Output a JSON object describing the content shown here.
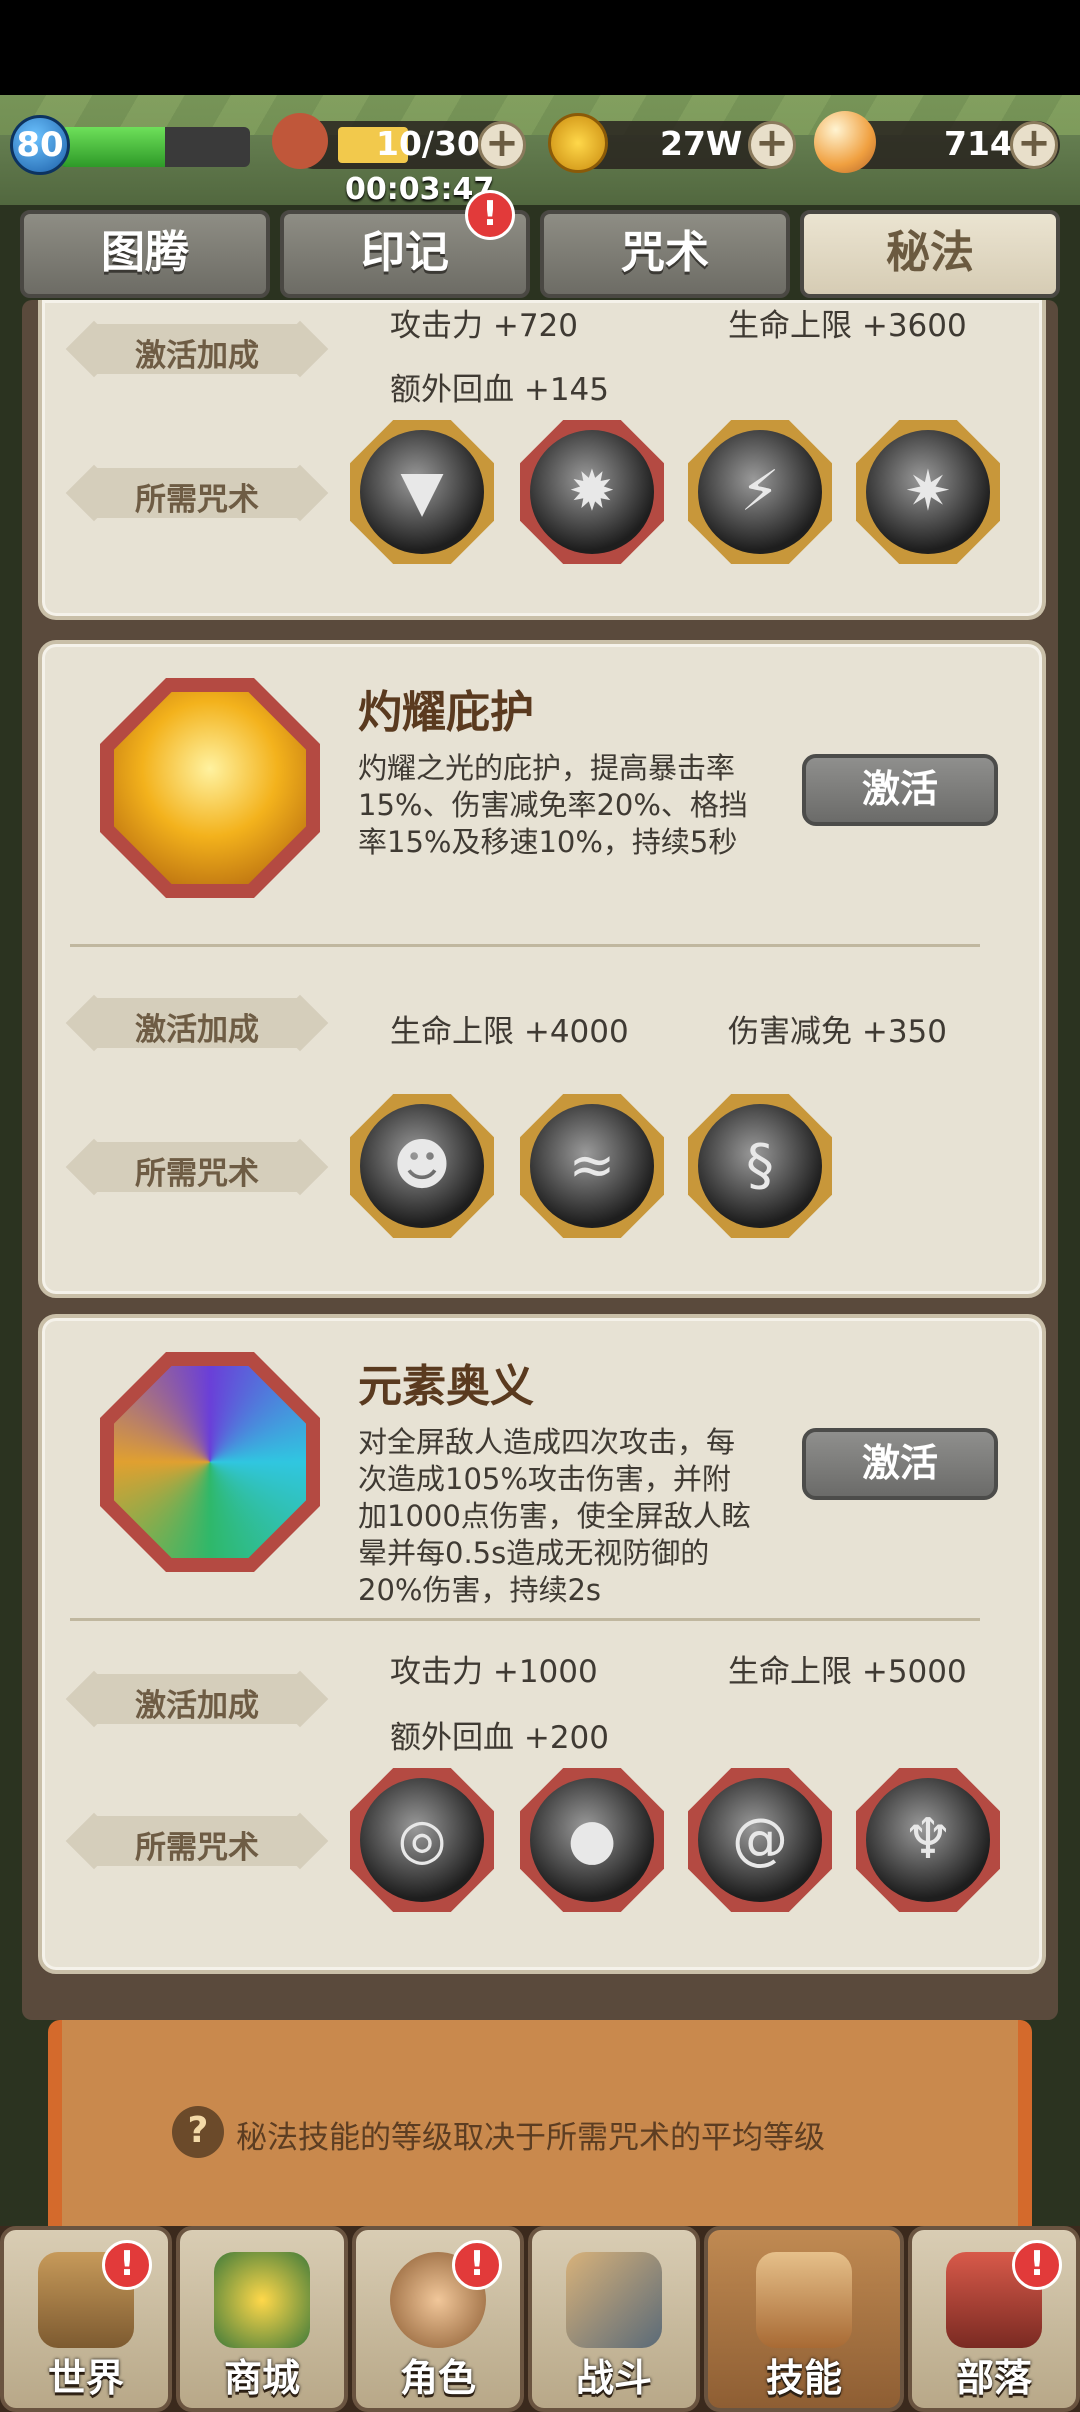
{
  "header": {
    "level": "80",
    "xp_fraction": 0.55,
    "stamina": "10/30",
    "stamina_timer": "00:03:47",
    "gold": "27W",
    "gems": "714"
  },
  "tabs": [
    {
      "label": "图腾",
      "active": false
    },
    {
      "label": "印记",
      "active": false,
      "badge": "!"
    },
    {
      "label": "咒术",
      "active": false
    },
    {
      "label": "秘法",
      "active": true
    }
  ],
  "labels": {
    "bonus": "激活加成",
    "required": "所需咒术",
    "activate": "激活"
  },
  "cards": [
    {
      "stats": [
        "攻击力 +720",
        "生命上限 +3600",
        "额外回血 +145"
      ],
      "spells": [
        "fang-spell-icon",
        "beast-spell-icon",
        "lightning-spell-icon",
        "sunburst-spell-icon"
      ]
    },
    {
      "title": "灼耀庇护",
      "description": "灼耀之光的庇护，提高暴击率15%、伤害减免率20%、格挡率15%及移速10%，持续5秒",
      "stats": [
        "生命上限 +4000",
        "伤害减免 +350"
      ],
      "spells": [
        "beast-head-spell-icon",
        "wave-spell-icon",
        "serpent-spell-icon"
      ]
    },
    {
      "title": "元素奥义",
      "description": "对全屏敌人造成四次攻击，每次造成105%攻击伤害，并附加1000点伤害，使全屏敌人眩晕并每0.5s造成无视防御的20%伤害，持续2s",
      "stats": [
        "攻击力 +1000",
        "生命上限 +5000",
        "额外回血 +200"
      ],
      "spells": [
        "ring-spell-icon",
        "orb-spell-icon",
        "whirl-spell-icon",
        "dragon-spell-icon"
      ]
    }
  ],
  "footer_info": "秘法技能的等级取决于所需咒术的平均等级",
  "nav": [
    {
      "label": "世界",
      "badge": "!"
    },
    {
      "label": "商城"
    },
    {
      "label": "角色",
      "badge": "!"
    },
    {
      "label": "战斗"
    },
    {
      "label": "技能",
      "active": true
    },
    {
      "label": "部落",
      "badge": "!"
    }
  ]
}
